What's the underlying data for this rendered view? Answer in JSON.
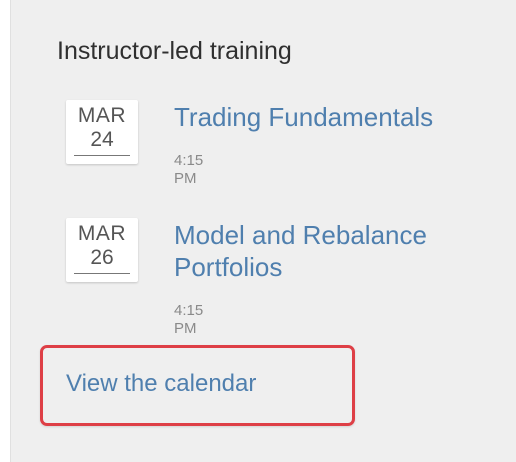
{
  "section": {
    "title": "Instructor-led training"
  },
  "events": [
    {
      "month": "MAR",
      "day": "24",
      "title": "Trading Fundamentals",
      "time": "4:15 PM"
    },
    {
      "month": "MAR",
      "day": "26",
      "title": "Model and Rebalance Portfolios",
      "time": "4:15 PM"
    }
  ],
  "footer": {
    "calendar_link": "View the calendar"
  },
  "colors": {
    "background": "#efefef",
    "link": "#4f7fae",
    "highlight": "#de3f46",
    "title": "#2f2f2f",
    "muted": "#8a8a8a"
  }
}
